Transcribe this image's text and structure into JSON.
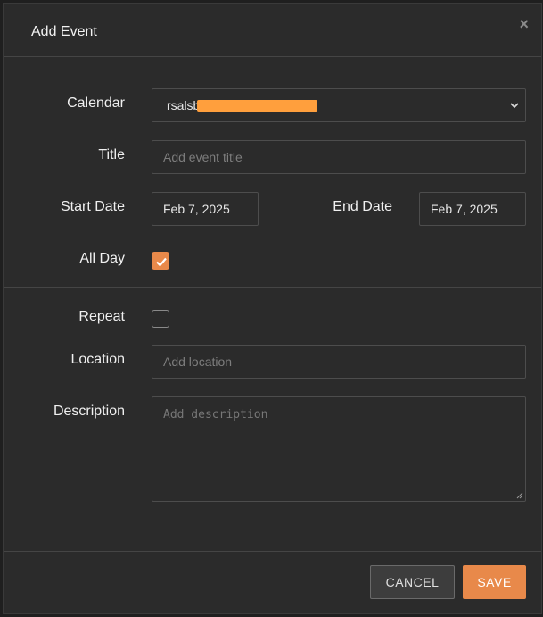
{
  "dialog": {
    "title": "Add Event",
    "close_glyph": "×"
  },
  "form": {
    "calendar": {
      "label": "Calendar",
      "value": "rsalsb"
    },
    "title": {
      "label": "Title",
      "placeholder": "Add event title"
    },
    "start_date": {
      "label": "Start Date",
      "value": "Feb 7, 2025"
    },
    "end_date": {
      "label": "End Date",
      "value": "Feb 7, 2025"
    },
    "all_day": {
      "label": "All Day",
      "checked": true
    },
    "repeat": {
      "label": "Repeat",
      "checked": false
    },
    "location": {
      "label": "Location",
      "placeholder": "Add location"
    },
    "description": {
      "label": "Description",
      "placeholder": "Add description"
    }
  },
  "footer": {
    "cancel_label": "CANCEL",
    "save_label": "SAVE"
  },
  "colors": {
    "accent": "#e8894a",
    "background": "#2b2b2b",
    "border": "#4d4d4d"
  },
  "icons": {
    "close": "close-icon",
    "chevron": "chevron-down-icon",
    "check": "checkmark-icon"
  }
}
